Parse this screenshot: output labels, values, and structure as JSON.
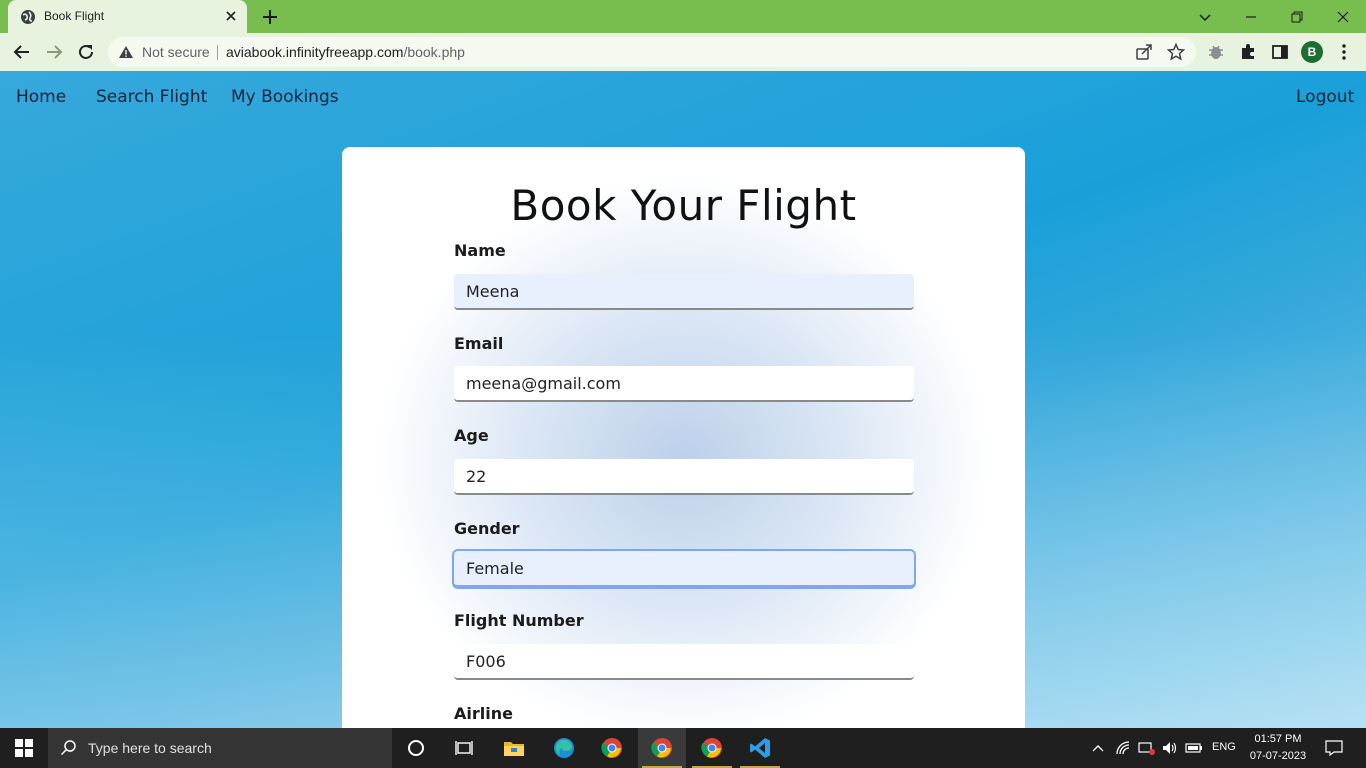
{
  "browser": {
    "tab_title": "Book Flight",
    "security_label": "Not secure",
    "url_host": "aviabook.infinityfreeapp.com",
    "url_path": "/book.php",
    "profile_initial": "B"
  },
  "nav": {
    "home": "Home",
    "search_flight": "Search Flight",
    "my_bookings": "My Bookings",
    "logout": "Logout"
  },
  "form": {
    "title": "Book Your Flight",
    "fields": [
      {
        "label": "Name",
        "value": "Meena"
      },
      {
        "label": "Email",
        "value": "meena@gmail.com"
      },
      {
        "label": "Age",
        "value": "22"
      },
      {
        "label": "Gender",
        "value": "Female"
      },
      {
        "label": "Flight Number",
        "value": "F006"
      },
      {
        "label": "Airline",
        "value": ""
      }
    ]
  },
  "taskbar": {
    "search_placeholder": "Type here to search",
    "language": "ENG",
    "time": "01:57 PM",
    "date": "07-07-2023"
  },
  "colors": {
    "chrome_tabstrip": "#78be4f",
    "chrome_toolbar": "#e8f3df",
    "page_background": "#1aa0d9",
    "focus_outline": "#7fa6ee",
    "taskbar": "#1f1f1f"
  },
  "icons": [
    "globe-icon",
    "close-icon",
    "plus-icon",
    "back-icon",
    "forward-icon",
    "reload-icon",
    "warning-icon",
    "share-icon",
    "star-icon",
    "extension-bug-icon",
    "puzzle-icon",
    "side-panel-icon",
    "windows-start-icon",
    "search-icon",
    "cortana-icon",
    "task-view-icon",
    "file-explorer-icon",
    "edge-icon",
    "chrome-icon",
    "vscode-icon",
    "chevron-up-icon",
    "network-icon",
    "battery-icon",
    "volume-icon",
    "notification-icon"
  ]
}
